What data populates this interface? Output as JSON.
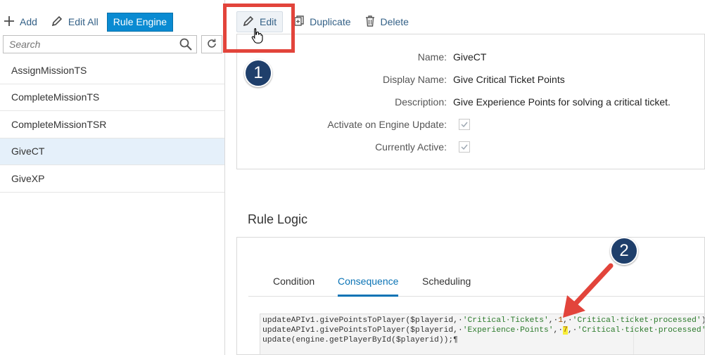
{
  "toolbar_left": {
    "add_label": "Add",
    "edit_all_label": "Edit All",
    "rule_engine_label": "Rule Engine"
  },
  "search": {
    "placeholder": "Search"
  },
  "rules": [
    {
      "name": "AssignMissionTS",
      "selected": false
    },
    {
      "name": "CompleteMissionTS",
      "selected": false
    },
    {
      "name": "CompleteMissionTSR",
      "selected": false
    },
    {
      "name": "GiveCT",
      "selected": true
    },
    {
      "name": "GiveXP",
      "selected": false
    }
  ],
  "toolbar_right": {
    "edit_label": "Edit",
    "duplicate_label": "Duplicate",
    "delete_label": "Delete"
  },
  "detail": {
    "name_label": "Name:",
    "name_value": "GiveCT",
    "display_name_label": "Display Name:",
    "display_name_value": "Give Critical Ticket Points",
    "description_label": "Description:",
    "description_value": "Give Experience Points for solving a critical ticket.",
    "activate_label": "Activate on Engine Update:",
    "activate_checked": true,
    "active_label": "Currently Active:",
    "active_checked": true
  },
  "annotations": {
    "badge1": "1",
    "badge2": "2"
  },
  "rule_logic": {
    "title": "Rule Logic",
    "tabs": [
      "Condition",
      "Consequence",
      "Scheduling"
    ],
    "active_tab": "Consequence",
    "code": {
      "l1_pre": "updateAPIv1.givePointsToPlayer($playerid,·",
      "l1_s1": "'Critical·Tickets'",
      "l1_mid": ",·",
      "l1_n": "1",
      "l1_mid2": ",·",
      "l1_s2": "'Critical·ticket·processed'",
      "l1_post": ");·",
      "l2_pre": "updateAPIv1.givePointsToPlayer($playerid,·",
      "l2_s1": "'Experience·Points'",
      "l2_mid": ",·",
      "l2_n": "7",
      "l2_mid2": ",·",
      "l2_s2": "'Critical·ticket·processed'",
      "l2_post": ");",
      "l3": "update(engine.getPlayerById($playerid));¶"
    }
  },
  "colors": {
    "accent": "#0a8bd2",
    "link": "#346187",
    "annotation_red": "#e2443b",
    "badge_navy": "#1f3f6b",
    "selected_row": "#e5f0fa",
    "highlight_yellow": "#f7ee3a"
  },
  "icons": [
    "plus-icon",
    "pencil-icon",
    "search-icon",
    "refresh-icon",
    "duplicate-icon",
    "trash-icon",
    "checkmark-icon",
    "hand-cursor-icon",
    "arrow-icon"
  ]
}
